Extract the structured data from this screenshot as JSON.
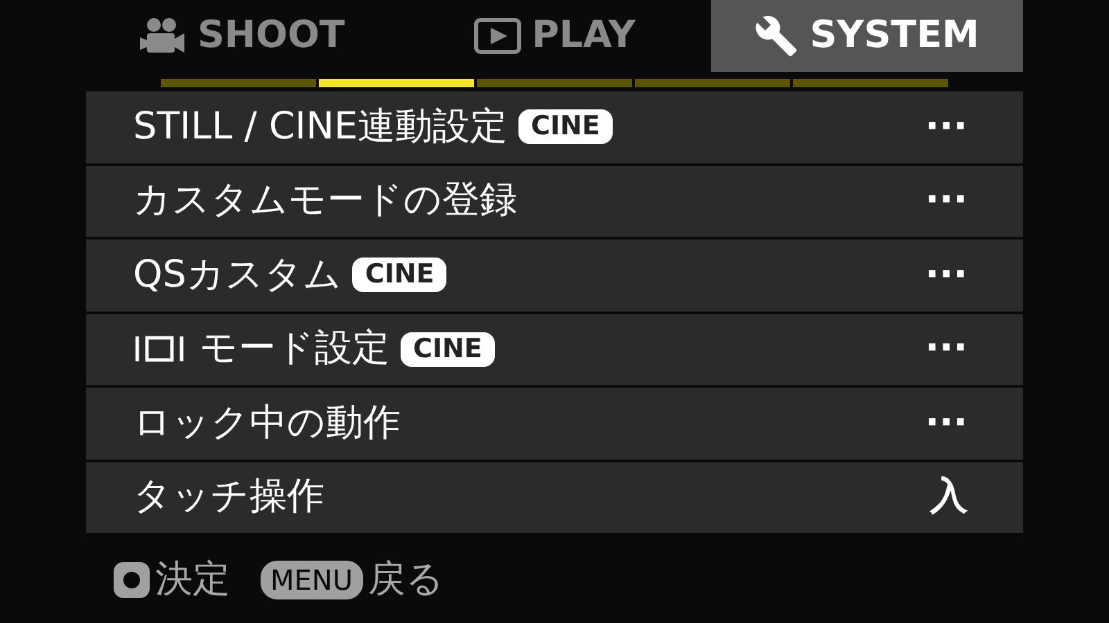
{
  "tabs": [
    {
      "label": "SHOOT",
      "selected": false
    },
    {
      "label": "PLAY",
      "selected": false
    },
    {
      "label": "SYSTEM",
      "selected": true
    }
  ],
  "pages": [
    {
      "selected": false
    },
    {
      "selected": true
    },
    {
      "selected": false
    },
    {
      "selected": false
    },
    {
      "selected": false
    }
  ],
  "rows": [
    {
      "label": "STILL / CINE連動設定",
      "badge": "CINE",
      "value": "···"
    },
    {
      "label": "カスタムモードの登録",
      "value": "···"
    },
    {
      "label": "QSカスタム",
      "badge": "CINE",
      "value": "···"
    },
    {
      "kind": "frame",
      "label": "モード設定",
      "badge": "CINE",
      "value": "···"
    },
    {
      "label": "ロック中の動作",
      "value": "···"
    },
    {
      "label": "タッチ操作",
      "value": "入"
    }
  ],
  "footer": [
    {
      "kind": "button",
      "label": "決定"
    },
    {
      "kind": "key",
      "key": "MENU",
      "label": "戻る"
    }
  ]
}
